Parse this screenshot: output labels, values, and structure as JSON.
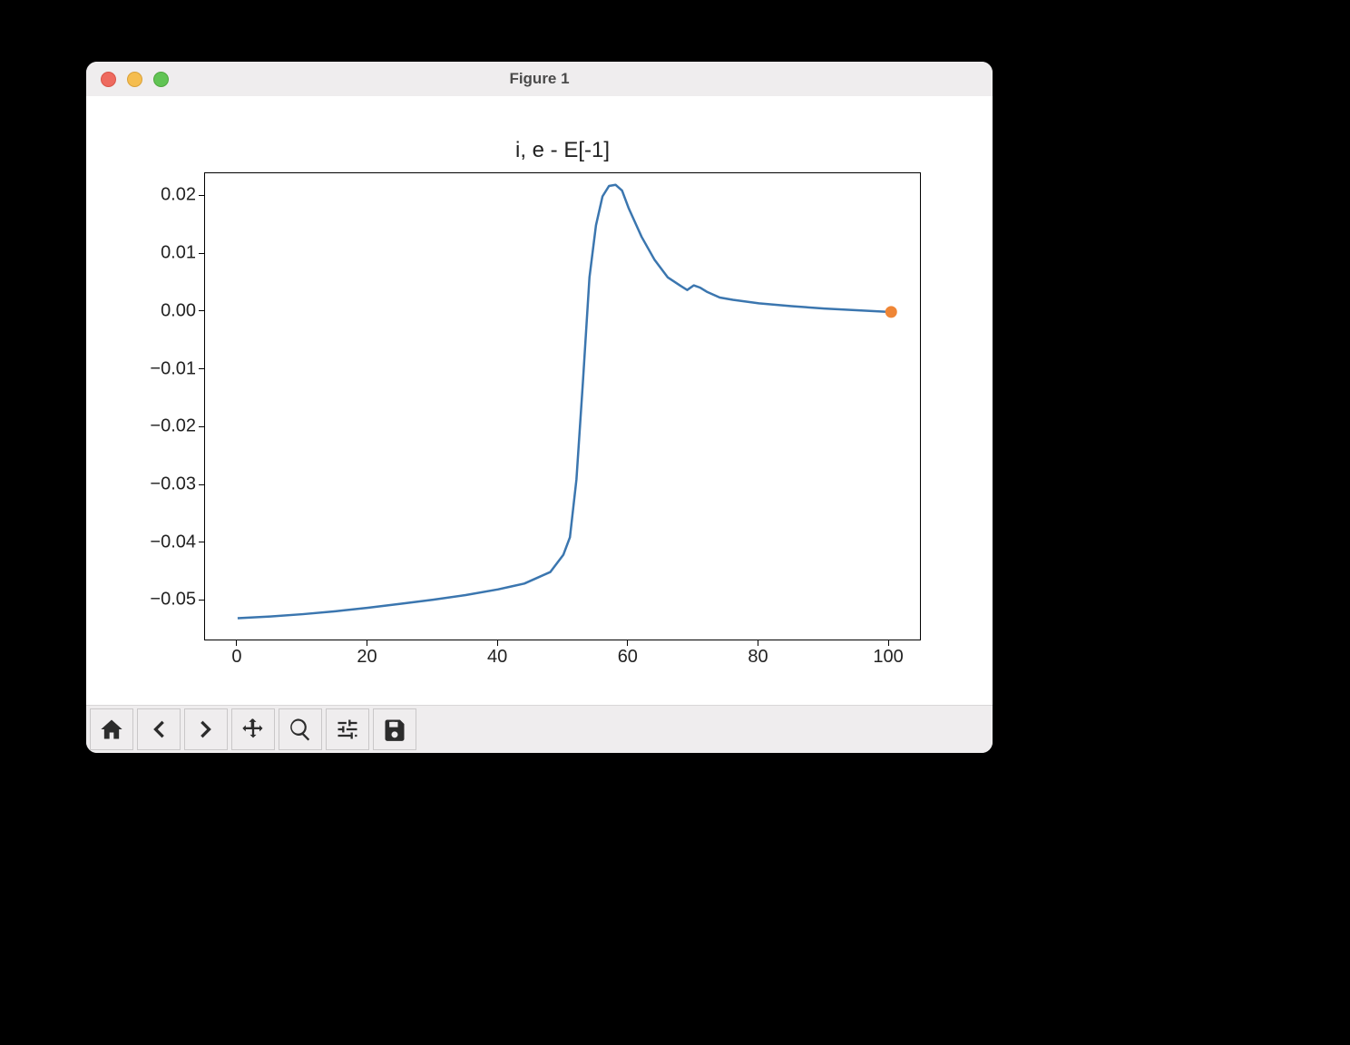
{
  "window_title": "Figure 1",
  "colors": {
    "line": "#3b76af",
    "marker": "#ef8636"
  },
  "toolbar": {
    "home": "Home",
    "back": "Back",
    "forward": "Forward",
    "pan": "Pan",
    "zoom": "Zoom",
    "configure": "Configure subplots",
    "save": "Save"
  },
  "chart_data": {
    "type": "line",
    "title": "i, e - E[-1]",
    "xlabel": "",
    "ylabel": "",
    "xlim": [
      -5,
      105
    ],
    "ylim": [
      -0.057,
      0.024
    ],
    "xticks": [
      0,
      20,
      40,
      60,
      80,
      100
    ],
    "yticks": [
      -0.05,
      -0.04,
      -0.03,
      -0.02,
      -0.01,
      0.0,
      0.01,
      0.02
    ],
    "ytick_labels": [
      "−0.05",
      "−0.04",
      "−0.03",
      "−0.02",
      "−0.01",
      "0.00",
      "0.01",
      "0.02"
    ],
    "series": [
      {
        "name": "e - E[-1]",
        "x": [
          0,
          5,
          10,
          15,
          20,
          25,
          30,
          35,
          40,
          42,
          44,
          46,
          48,
          50,
          51,
          52,
          53,
          54,
          55,
          56,
          57,
          58,
          59,
          60,
          62,
          64,
          66,
          68,
          69,
          70,
          71,
          72,
          74,
          76,
          80,
          85,
          90,
          95,
          100
        ],
        "values": [
          -0.053,
          -0.0527,
          -0.0523,
          -0.0518,
          -0.0512,
          -0.0505,
          -0.0498,
          -0.049,
          -0.048,
          -0.0475,
          -0.047,
          -0.046,
          -0.045,
          -0.042,
          -0.039,
          -0.029,
          -0.012,
          0.006,
          0.015,
          0.02,
          0.0218,
          0.022,
          0.021,
          0.018,
          0.013,
          0.009,
          0.006,
          0.0045,
          0.0038,
          0.0046,
          0.0042,
          0.0035,
          0.0025,
          0.0021,
          0.0015,
          0.001,
          0.0006,
          0.0003,
          0.0
        ]
      }
    ],
    "markers": [
      {
        "name": "endpoint",
        "x": 100.3,
        "y": 0.0
      }
    ]
  }
}
